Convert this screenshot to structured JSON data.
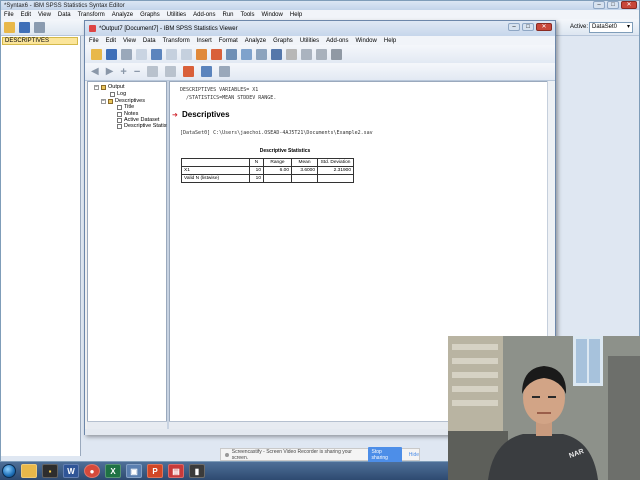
{
  "syntax_window": {
    "title": "*Syntax6 - IBM SPSS Statistics Syntax Editor",
    "menu": [
      "File",
      "Edit",
      "View",
      "Data",
      "Transform",
      "Analyze",
      "Graphs",
      "Utilities",
      "Add-ons",
      "Run",
      "Tools",
      "Window",
      "Help"
    ],
    "active_label": "Active:",
    "active_dataset": "DataSet0",
    "left_pane_item": "DESCRIPTIVES"
  },
  "viewer": {
    "title": "*Output7 [Document7] - IBM SPSS Statistics Viewer",
    "menu": [
      "File",
      "Edit",
      "View",
      "Data",
      "Transform",
      "Insert",
      "Format",
      "Analyze",
      "Graphs",
      "Utilities",
      "Add-ons",
      "Window",
      "Help"
    ],
    "outline": {
      "root": "Output",
      "log": "Log",
      "descriptives": "Descriptives",
      "title": "Title",
      "notes": "Notes",
      "active_dataset": "Active Dataset",
      "descriptive_statistics": "Descriptive Statisti"
    },
    "content": {
      "syntax_line1": "DESCRIPTIVES VARIABLES= X1",
      "syntax_line2": "  /STATISTICS=MEAN STDDEV RANGE.",
      "procedure_title": "Descriptives",
      "dataset_line": "[DataSet0] C:\\Users\\jaechoi.OSEAD-4AJ5T21\\Documents\\Example2.sav",
      "table_title": "Descriptive Statistics",
      "table_headers": [
        "",
        "N",
        "Range",
        "Mean",
        "Std. Deviation"
      ],
      "table_rows": [
        [
          "X1",
          "10",
          "6.00",
          "3.6000",
          "2.31900"
        ],
        [
          "Valid N (listwise)",
          "10",
          "",
          "",
          ""
        ]
      ]
    }
  },
  "share_bar": {
    "message": "Screencastify - Screen Video Recorder is sharing your screen.",
    "stop_label": "Stop sharing",
    "hide_label": "Hide"
  },
  "taskbar": {
    "icons": [
      "folder-icon",
      "chat-icon",
      "word-icon",
      "chrome-icon",
      "excel-icon",
      "network-icon",
      "powerpoint-icon",
      "spss-icon",
      "terminal-icon"
    ]
  },
  "colors": {
    "desktop": "#6f8fb5",
    "selection": "#fbe59a",
    "procedure_arrow": "#d0242c",
    "stop_button": "#4d8ee8"
  }
}
